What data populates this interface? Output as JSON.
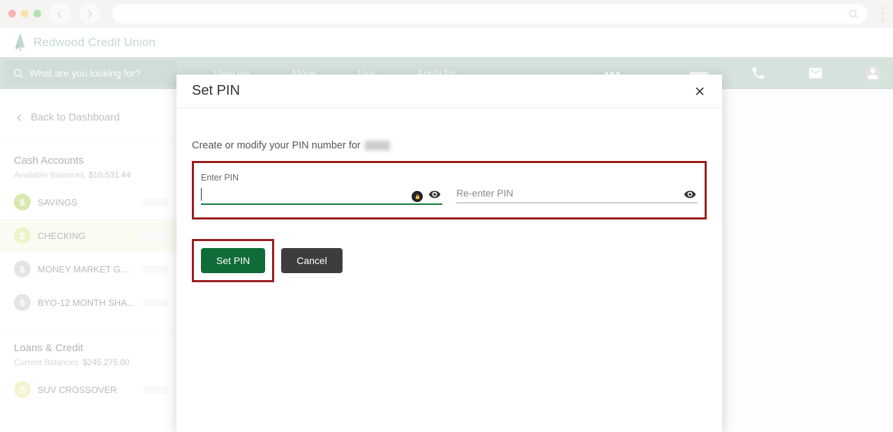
{
  "brand": "Redwood Credit Union",
  "search": {
    "placeholder": "What are you looking for?"
  },
  "nav": {
    "items": [
      "View my",
      "Move",
      "Use",
      "Apply for"
    ]
  },
  "sidebar": {
    "back_label": "Back to Dashboard",
    "cash": {
      "title": "Cash Accounts",
      "subtitle": "Available Balances",
      "balance": "$10,531.44",
      "accounts": [
        {
          "name": "SAVINGS"
        },
        {
          "name": "CHECKING"
        },
        {
          "name": "MONEY MARKET GRO..."
        },
        {
          "name": "BYO-12 MONTH SHA..."
        }
      ]
    },
    "loans": {
      "title": "Loans & Credit",
      "subtitle": "Current Balances",
      "balance": "$245,275.00",
      "accounts": [
        {
          "name": "SUV CROSSOVER"
        }
      ]
    }
  },
  "modal": {
    "title": "Set PIN",
    "description": "Create or modify your PIN number for",
    "enter_label": "Enter PIN",
    "reenter_placeholder": "Re-enter PIN",
    "set_button": "Set PIN",
    "cancel_button": "Cancel"
  }
}
